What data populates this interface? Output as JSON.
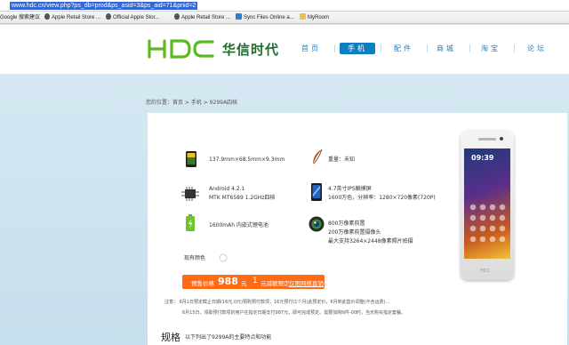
{
  "browser": {
    "url": "www.hdc.cn/view.php?ps_db=prod&ps_asid=3&ps_aid=71&pnid=2",
    "bookmarks": [
      {
        "label": "Google 搜索建议",
        "icon": "google-icon"
      },
      {
        "label": "Apple Retail Store ...",
        "icon": "apple-icon"
      },
      {
        "label": "Official Apple Stor...",
        "icon": "apple-icon"
      },
      {
        "label": "Apple Retail Store ...",
        "icon": "apple-icon"
      },
      {
        "label": "Sync Files Online a...",
        "icon": "sync-icon"
      },
      {
        "label": "MyRoom",
        "icon": "folder-icon"
      }
    ]
  },
  "header": {
    "logo_text": "HDC",
    "brand": "华信时代",
    "nav": [
      "首页",
      "手机",
      "配件",
      "商城",
      "淘宝",
      "论坛"
    ],
    "active_nav": "手机",
    "colors": {
      "nav_active": "#0c7ec2",
      "logo_green": "#5cb91f"
    }
  },
  "breadcrumb": "您的位置：首页 > 手机 > 9299A四核",
  "specs": {
    "size": "137.9mm×68.5mm×9.3mm",
    "weight": "重量：未知",
    "os_line1": "Android 4.2.1",
    "os_line2": "MTK  MT6589  1.2GHz四核",
    "screen_line1": "4.7英寸IPS触摸屏",
    "screen_line2": "1600万色，分辨率：1280×720像素(720P)",
    "battery": "1600mAh 内嵌式锂电池",
    "camera_line1": "800万像素前置",
    "camera_line2": "200万像素前置摄像头",
    "camera_line3": "最大支持3264×2448像素照片拍摄",
    "color_label": "现有颜色"
  },
  "price": {
    "prefix": "预售价格",
    "value": "988",
    "unit": "元",
    "deposit": "1",
    "deposit_text": "元减额预定",
    "link": "仅限网络直销"
  },
  "notes": {
    "line1": "注意：  6月1日预定截止日期(16元,0元)预购预付款项，16元预付(1个月)此预定价，6月到此售价调整(不含运费)…",
    "line2": "6月15日，领取预付款项的用户在指定日期支付987元，即可完成预定。需要加购N件-00时，当天购买指定套餐。"
  },
  "spec_heading": {
    "title": "规格",
    "subtitle": "以下列出了9299A的主要特点和功能"
  },
  "phone": {
    "clock": "09:39",
    "brand": "HDC"
  }
}
